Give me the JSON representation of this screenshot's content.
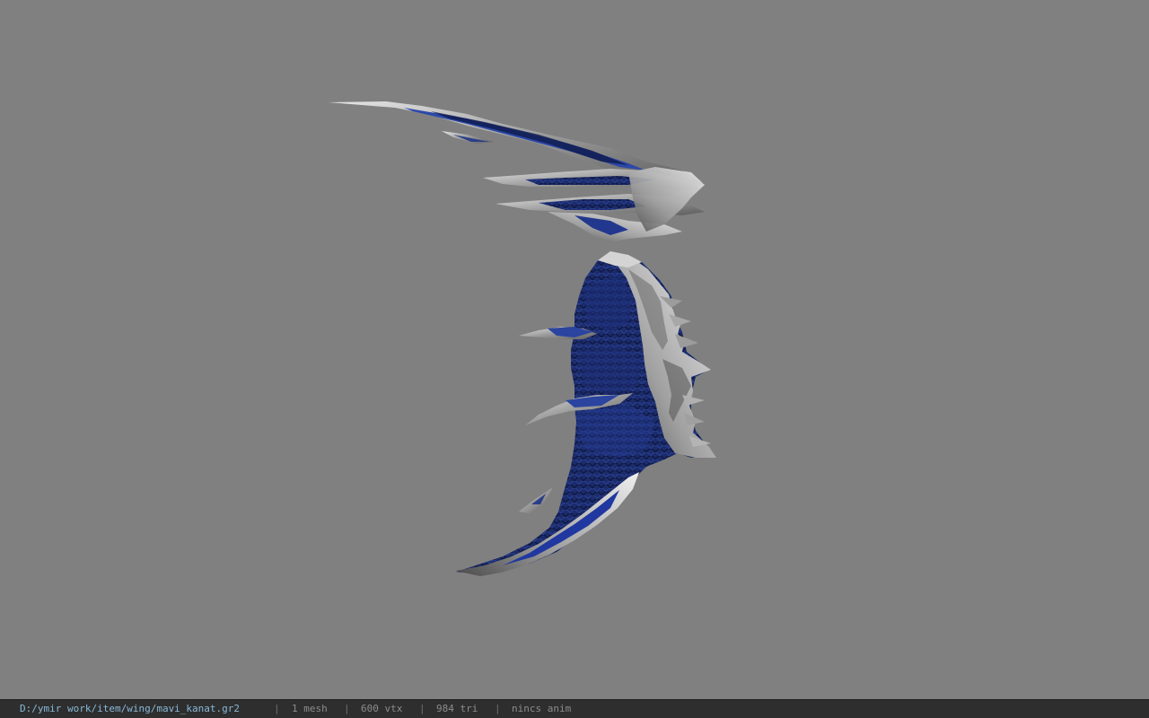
{
  "viewer": {
    "background_color": "#808080",
    "model": {
      "primary_color": "#1f2f6e",
      "accent_color": "#2a4bb0",
      "metal_color": "#b8b8b8"
    }
  },
  "status_bar": {
    "file_path": "D:/ymir work/item/wing/mavi_kanat.gr2",
    "separator": "|",
    "mesh_count": "1 mesh",
    "vertex_count": "600 vtx",
    "triangle_count": "984 tri",
    "animation": "nincs anim"
  }
}
